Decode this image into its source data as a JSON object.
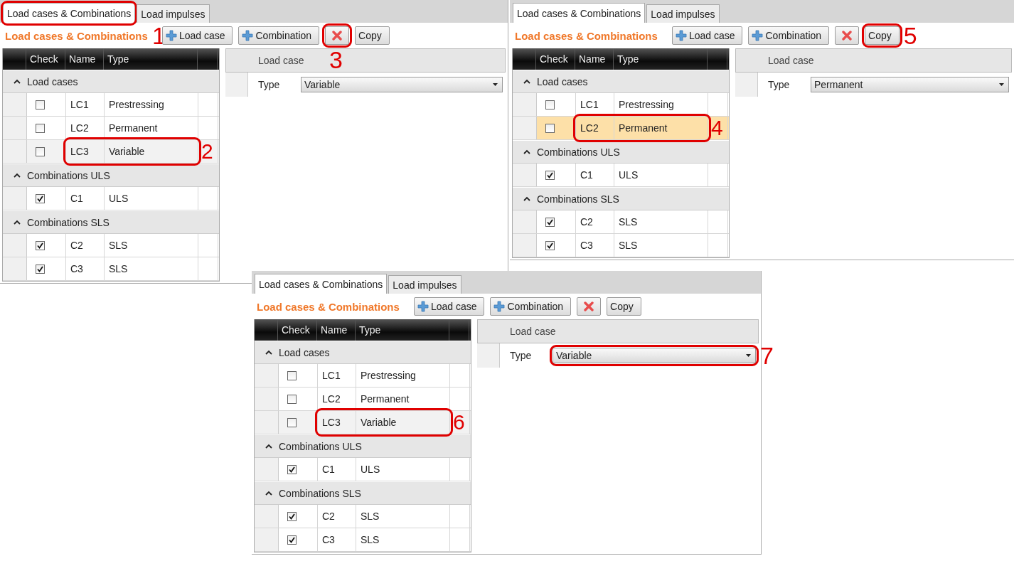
{
  "panels": [
    {
      "tabs": [
        {
          "label": "Load cases & Combinations",
          "selected": true,
          "highlighted": true
        },
        {
          "label": "Load impulses",
          "selected": false,
          "highlighted": false
        }
      ],
      "heading": {
        "text": "Load cases & Combinations",
        "callout": "1"
      },
      "toolbar": [
        {
          "kind": "add",
          "label": "Load case",
          "highlighted": false
        },
        {
          "kind": "add",
          "label": "Combination",
          "highlighted": false
        },
        {
          "kind": "delete",
          "highlighted": true,
          "callout": "3"
        },
        {
          "kind": "plain",
          "label": "Copy",
          "highlighted": false
        }
      ],
      "grid": {
        "columns": [
          "Check",
          "Name",
          "Type"
        ],
        "groups": [
          {
            "title": "Load cases",
            "expanded": true,
            "rows": [
              {
                "checked": false,
                "name": "LC1",
                "type": "Prestressing",
                "selected": false,
                "highlighted": false
              },
              {
                "checked": false,
                "name": "LC2",
                "type": "Permanent",
                "selected": false,
                "highlighted": false
              },
              {
                "checked": false,
                "name": "LC3",
                "type": "Variable",
                "selected": false,
                "highlighted": true,
                "callout": "2"
              }
            ]
          },
          {
            "title": "Combinations ULS",
            "expanded": true,
            "rows": [
              {
                "checked": true,
                "name": "C1",
                "type": "ULS",
                "selected": false,
                "highlighted": false
              }
            ]
          },
          {
            "title": "Combinations SLS",
            "expanded": true,
            "rows": [
              {
                "checked": true,
                "name": "C2",
                "type": "SLS",
                "selected": false,
                "highlighted": false
              },
              {
                "checked": true,
                "name": "C3",
                "type": "SLS",
                "selected": false,
                "highlighted": false
              }
            ]
          }
        ]
      },
      "properties": {
        "header": "Load case",
        "field_label": "Type",
        "value": "Variable"
      }
    },
    {
      "tabs": [
        {
          "label": "Load cases & Combinations",
          "selected": true,
          "highlighted": false
        },
        {
          "label": "Load impulses",
          "selected": false,
          "highlighted": false
        }
      ],
      "heading": {
        "text": "Load cases & Combinations"
      },
      "toolbar": [
        {
          "kind": "add",
          "label": "Load case",
          "highlighted": false
        },
        {
          "kind": "add",
          "label": "Combination",
          "highlighted": false
        },
        {
          "kind": "delete",
          "highlighted": false
        },
        {
          "kind": "plain",
          "label": "Copy",
          "highlighted": true,
          "callout": "5"
        }
      ],
      "grid": {
        "columns": [
          "Check",
          "Name",
          "Type"
        ],
        "groups": [
          {
            "title": "Load cases",
            "expanded": true,
            "rows": [
              {
                "checked": false,
                "name": "LC1",
                "type": "Prestressing",
                "selected": false,
                "highlighted": false
              },
              {
                "checked": false,
                "name": "LC2",
                "type": "Permanent",
                "selected": true,
                "highlighted": true,
                "callout": "4"
              }
            ]
          },
          {
            "title": "Combinations ULS",
            "expanded": true,
            "rows": [
              {
                "checked": true,
                "name": "C1",
                "type": "ULS",
                "selected": false,
                "highlighted": false
              }
            ]
          },
          {
            "title": "Combinations SLS",
            "expanded": true,
            "rows": [
              {
                "checked": true,
                "name": "C2",
                "type": "SLS",
                "selected": false,
                "highlighted": false
              },
              {
                "checked": true,
                "name": "C3",
                "type": "SLS",
                "selected": false,
                "highlighted": false
              }
            ]
          }
        ]
      },
      "properties": {
        "header": "Load case",
        "field_label": "Type",
        "value": "Permanent"
      }
    },
    {
      "tabs": [
        {
          "label": "Load cases & Combinations",
          "selected": true,
          "highlighted": false
        },
        {
          "label": "Load impulses",
          "selected": false,
          "highlighted": false
        }
      ],
      "heading": {
        "text": "Load cases & Combinations"
      },
      "toolbar": [
        {
          "kind": "add",
          "label": "Load case",
          "highlighted": false
        },
        {
          "kind": "add",
          "label": "Combination",
          "highlighted": false
        },
        {
          "kind": "delete",
          "highlighted": false
        },
        {
          "kind": "plain",
          "label": "Copy",
          "highlighted": false
        }
      ],
      "grid": {
        "columns": [
          "Check",
          "Name",
          "Type"
        ],
        "groups": [
          {
            "title": "Load cases",
            "expanded": true,
            "rows": [
              {
                "checked": false,
                "name": "LC1",
                "type": "Prestressing",
                "selected": false,
                "highlighted": false
              },
              {
                "checked": false,
                "name": "LC2",
                "type": "Permanent",
                "selected": false,
                "highlighted": false
              },
              {
                "checked": false,
                "name": "LC3",
                "type": "Variable",
                "selected": false,
                "highlighted": true,
                "callout": "6"
              }
            ]
          },
          {
            "title": "Combinations ULS",
            "expanded": true,
            "rows": [
              {
                "checked": true,
                "name": "C1",
                "type": "ULS",
                "selected": false,
                "highlighted": false
              }
            ]
          },
          {
            "title": "Combinations SLS",
            "expanded": true,
            "rows": [
              {
                "checked": true,
                "name": "C2",
                "type": "SLS",
                "selected": false,
                "highlighted": false
              },
              {
                "checked": true,
                "name": "C3",
                "type": "SLS",
                "selected": false,
                "highlighted": false
              }
            ]
          }
        ]
      },
      "properties": {
        "header": "Load case",
        "field_label": "Type",
        "value": "Variable",
        "highlighted": true,
        "callout": "7"
      }
    }
  ]
}
